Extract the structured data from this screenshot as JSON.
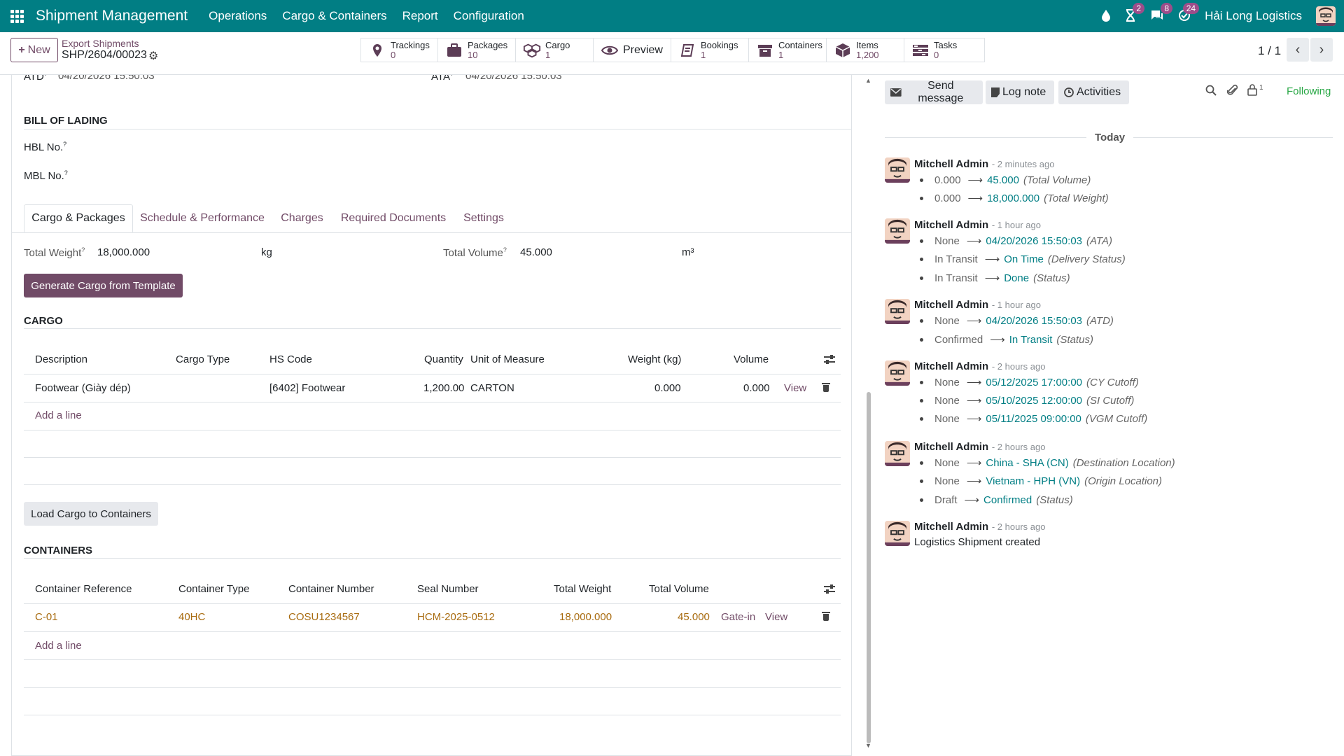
{
  "topbar": {
    "brand": "Shipment Management",
    "menu": [
      "Operations",
      "Cargo & Containers",
      "Report",
      "Configuration"
    ],
    "activity_badge": "2",
    "messages_badge": "8",
    "updates_badge": "24",
    "company": "Hải Long Logistics"
  },
  "control": {
    "new_label": "New",
    "breadcrumb_parent": "Export Shipments",
    "breadcrumb_current": "SHP/2604/00023",
    "pager": "1 / 1"
  },
  "smart_buttons": [
    {
      "label": "Trackings",
      "value": "0",
      "icon": "map-pin-icon"
    },
    {
      "label": "Packages",
      "value": "10",
      "icon": "suitcase-icon"
    },
    {
      "label": "Cargo",
      "value": "1",
      "icon": "cubes-icon"
    },
    {
      "label": "Preview",
      "value": "",
      "icon": "eye-icon"
    },
    {
      "label": "Bookings",
      "value": "1",
      "icon": "book-icon"
    },
    {
      "label": "Containers",
      "value": "1",
      "icon": "archive-icon"
    },
    {
      "label": "Items",
      "value": "1,200",
      "icon": "box-icon"
    },
    {
      "label": "Tasks",
      "value": "0",
      "icon": "tasks-icon"
    }
  ],
  "form": {
    "atd_label": "ATD",
    "atd_value": "04/20/2026 15:50:03",
    "ata_label": "ATA",
    "ata_value": "04/20/2026 15:50:03",
    "bol_heading": "BILL OF LADING",
    "hbl_label": "HBL No.",
    "mbl_label": "MBL No.",
    "help_mark": "?",
    "tabs": [
      "Cargo & Packages",
      "Schedule & Performance",
      "Charges",
      "Required Documents",
      "Settings"
    ],
    "total_weight_label": "Total Weight",
    "total_weight_value": "18,000.000",
    "weight_unit": "kg",
    "total_volume_label": "Total Volume",
    "total_volume_value": "45.000",
    "volume_unit": "m³",
    "generate_btn": "Generate Cargo from Template",
    "load_btn": "Load Cargo to Containers",
    "add_line": "Add a line"
  },
  "cargo": {
    "heading": "CARGO",
    "headers": [
      "Description",
      "Cargo Type",
      "HS Code",
      "Quantity",
      "Unit of Measure",
      "Weight (kg)",
      "Volume"
    ],
    "rows": [
      {
        "description": "Footwear (Giày dép)",
        "cargo_type": "",
        "hs_code": "[6402] Footwear",
        "quantity": "1,200.00",
        "uom": "CARTON",
        "weight": "0.000",
        "volume": "0.000",
        "view": "View"
      }
    ]
  },
  "containers": {
    "heading": "CONTAINERS",
    "headers": [
      "Container Reference",
      "Container Type",
      "Container Number",
      "Seal Number",
      "Total Weight",
      "Total Volume"
    ],
    "rows": [
      {
        "reference": "C-01",
        "type": "40HC",
        "number": "COSU1234567",
        "seal": "HCM-2025-0512",
        "weight": "18,000.000",
        "volume": "45.000",
        "gate": "Gate-in",
        "view": "View"
      }
    ]
  },
  "chatter": {
    "send_message": "Send message",
    "log_note": "Log note",
    "activities": "Activities",
    "followers_count": "1",
    "following": "Following",
    "today": "Today",
    "arrow": "⟶",
    "messages": [
      {
        "author": "Mitchell Admin",
        "date": "- 2 minutes ago",
        "changes": [
          {
            "old": "0.000",
            "new": "45.000",
            "field": "(Total Volume)"
          },
          {
            "old": "0.000",
            "new": "18,000.000",
            "field": "(Total Weight)"
          }
        ]
      },
      {
        "author": "Mitchell Admin",
        "date": "- 1 hour ago",
        "changes": [
          {
            "old": "None",
            "new": "04/20/2026 15:50:03",
            "field": "(ATA)"
          },
          {
            "old": "In Transit",
            "new": "On Time",
            "field": "(Delivery Status)"
          },
          {
            "old": "In Transit",
            "new": "Done",
            "field": "(Status)"
          }
        ]
      },
      {
        "author": "Mitchell Admin",
        "date": "- 1 hour ago",
        "changes": [
          {
            "old": "None",
            "new": "04/20/2026 15:50:03",
            "field": "(ATD)"
          },
          {
            "old": "Confirmed",
            "new": "In Transit",
            "field": "(Status)"
          }
        ]
      },
      {
        "author": "Mitchell Admin",
        "date": "- 2 hours ago",
        "changes": [
          {
            "old": "None",
            "new": "05/12/2025 17:00:00",
            "field": "(CY Cutoff)"
          },
          {
            "old": "None",
            "new": "05/10/2025 12:00:00",
            "field": "(SI Cutoff)"
          },
          {
            "old": "None",
            "new": "05/11/2025 09:00:00",
            "field": "(VGM Cutoff)"
          }
        ]
      },
      {
        "author": "Mitchell Admin",
        "date": "- 2 hours ago",
        "changes": [
          {
            "old": "None",
            "new": "China - SHA (CN)",
            "field": "(Destination Location)"
          },
          {
            "old": "None",
            "new": "Vietnam - HPH (VN)",
            "field": "(Origin Location)"
          },
          {
            "old": "Draft",
            "new": "Confirmed",
            "field": "(Status)"
          }
        ]
      },
      {
        "author": "Mitchell Admin",
        "date": "- 2 hours ago",
        "body": "Logistics Shipment created"
      }
    ]
  },
  "colors": {
    "brand": "#017e84",
    "primary": "#714b67",
    "badge": "#9d4d8a",
    "gold": "#a86b0f",
    "link_teal": "#017e84",
    "following": "#28a745"
  }
}
